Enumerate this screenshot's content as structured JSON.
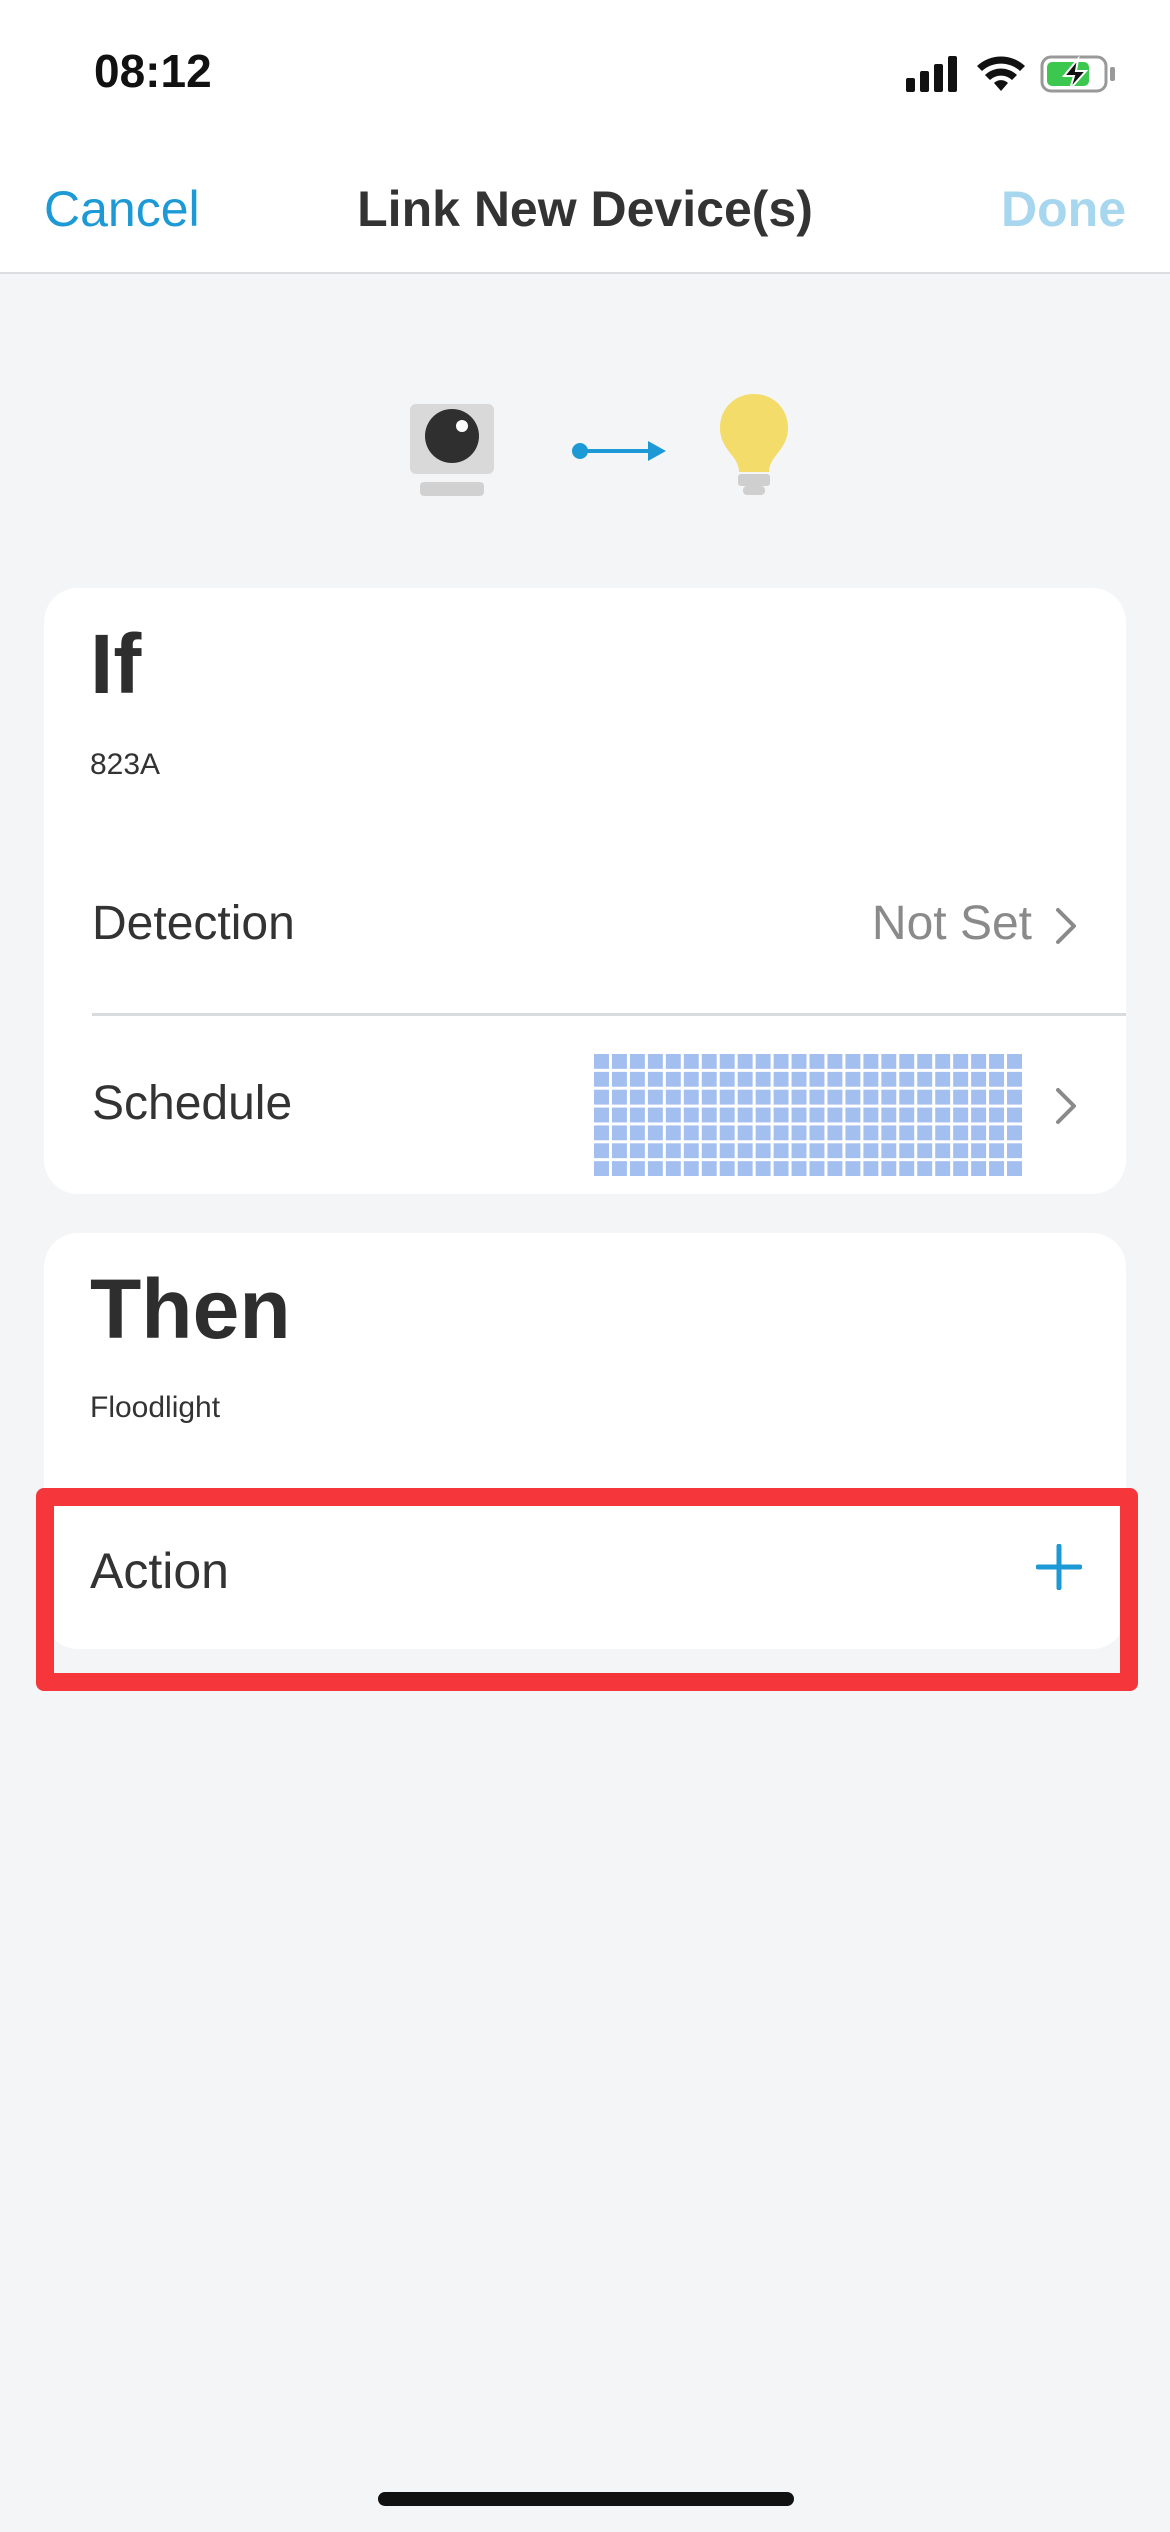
{
  "status_bar": {
    "time": "08:12",
    "icons": [
      "cellular-signal-icon",
      "wifi-icon",
      "battery-charging-icon"
    ]
  },
  "nav": {
    "cancel_label": "Cancel",
    "title": "Link New Device(s)",
    "done_label": "Done"
  },
  "device_graphic": {
    "icons": [
      "camera-icon",
      "arrow-right-icon",
      "light-bulb-icon"
    ]
  },
  "if_card": {
    "heading": "If",
    "device_name": "823A",
    "rows": [
      {
        "label": "Detection",
        "value": "Not Set"
      },
      {
        "label": "Schedule",
        "value": ""
      }
    ]
  },
  "then_card": {
    "heading": "Then",
    "device_name": "Floodlight",
    "action_label": "Action"
  },
  "colors": {
    "accent": "#1d9ad6",
    "done_disabled": "#a7d6ef",
    "highlight": "#f5373b",
    "schedule_cells": "#a3bff0",
    "bulb": "#f4dc6a"
  }
}
